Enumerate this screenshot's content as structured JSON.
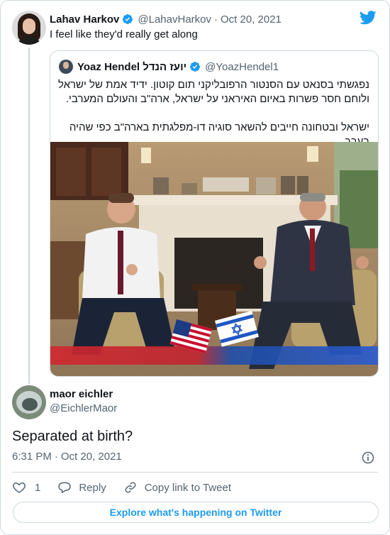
{
  "tweet": {
    "author_name": "Lahav Harkov",
    "author_handle": "@LahavHarkov",
    "separator": "·",
    "date": "Oct 20, 2021",
    "text": "I feel like they'd really get along"
  },
  "quote": {
    "author_name": "Yoaz Hendel יועז הנדל",
    "author_handle": "@YoazHendel1",
    "paragraph_1": "נפגשתי בסנאט עם הסנטור הרפובליקני תום קוטון. ידיד אמת של ישראל ולוחם חסר פשרות באיום האיראני על ישראל, ארה\"ב והעולם המערבי.",
    "paragraph_2": "ישראל ובטחונה חייבים להשאר סוגיה דו-מפלגתית בארה\"ב כפי שהיה בעבר."
  },
  "reply": {
    "author_name": "maor eichler",
    "author_handle": "@EichlerMaor",
    "text": "Separated at birth?",
    "time": "6:31 PM",
    "separator": "·",
    "date": "Oct 20, 2021"
  },
  "actions": {
    "like_count": "1",
    "reply_label": "Reply",
    "copy_link_label": "Copy link to Tweet"
  },
  "explore_label": "Explore what's happening on Twitter",
  "colors": {
    "twitter_blue": "#1d9bf0",
    "text_primary": "#0f1419",
    "text_secondary": "#536471",
    "border": "#cfd9de"
  }
}
